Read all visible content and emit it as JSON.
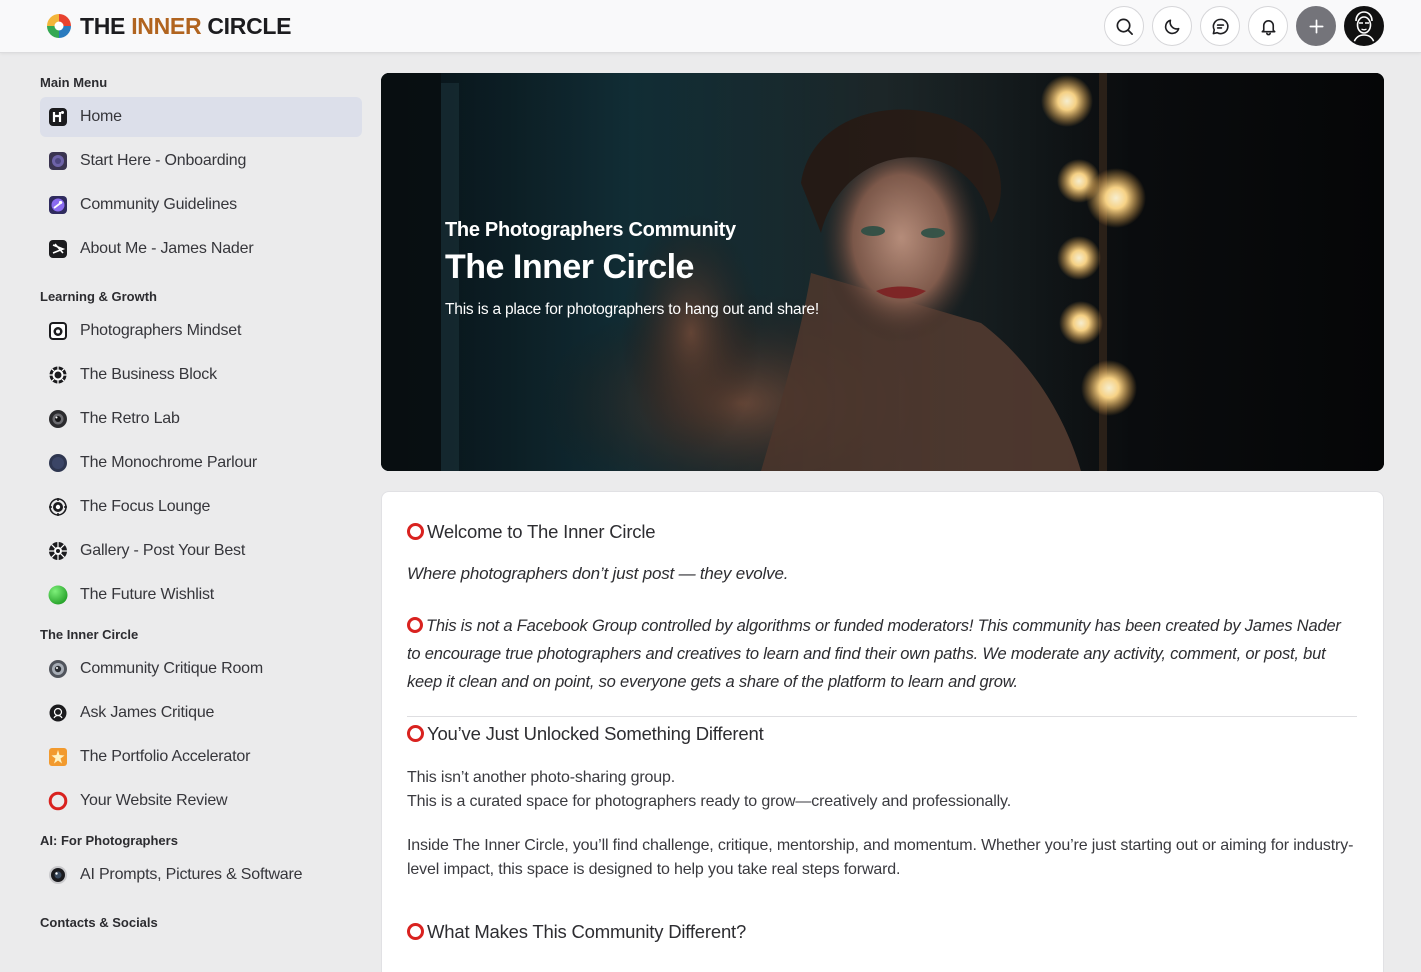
{
  "header": {
    "brand_prefix": "THE ",
    "brand_accent": "INNER",
    "brand_suffix": " CIRCLE",
    "actions": [
      {
        "name": "search-icon"
      },
      {
        "name": "moon-icon"
      },
      {
        "name": "chat-icon"
      },
      {
        "name": "bell-icon"
      },
      {
        "name": "plus-icon"
      },
      {
        "name": "avatar"
      }
    ]
  },
  "sidebar": {
    "main_menu": {
      "title": "Main Menu",
      "items": [
        {
          "label": "Home",
          "icon": "home-icon",
          "active": true
        },
        {
          "label": "Start Here - Onboarding",
          "icon": "onboarding-icon"
        },
        {
          "label": "Community Guidelines",
          "icon": "guidelines-icon"
        },
        {
          "label": "About Me - James Nader",
          "icon": "about-icon"
        }
      ]
    },
    "learning": {
      "title": "Learning & Growth",
      "items": [
        {
          "label": "Photographers Mindset",
          "icon": "camera-icon"
        },
        {
          "label": "The Business Block",
          "icon": "gear-icon"
        },
        {
          "label": "The Retro Lab",
          "icon": "retro-camera-icon"
        },
        {
          "label": "The Monochrome Parlour",
          "icon": "monochrome-icon"
        },
        {
          "label": "The Focus Lounge",
          "icon": "focus-icon"
        },
        {
          "label": "Gallery - Post Your Best",
          "icon": "aperture-icon"
        },
        {
          "label": "The Future Wishlist",
          "icon": "green-dot-icon"
        }
      ]
    },
    "inner_circle": {
      "title": "The Inner Circle",
      "items": [
        {
          "label": "Community Critique Room",
          "icon": "critique-icon"
        },
        {
          "label": "Ask James Critique",
          "icon": "ask-icon"
        },
        {
          "label": "The Portfolio Accelerator",
          "icon": "spark-icon"
        },
        {
          "label": "Your Website Review",
          "icon": "red-ring-icon"
        }
      ]
    },
    "ai": {
      "title": "AI: For Photographers",
      "items": [
        {
          "label": "AI Prompts, Pictures & Software",
          "icon": "lens-icon"
        }
      ]
    },
    "contacts": {
      "title": "Contacts & Socials"
    }
  },
  "hero": {
    "kicker": "The Photographers Community",
    "title": "The Inner Circle",
    "subtitle": "This is a place for photographers to hang out and share!"
  },
  "content": {
    "welcome_heading": "Welcome to The Inner Circle",
    "tagline": "Where photographers don’t just post — they evolve.",
    "intro": "This is not a Facebook Group controlled by algorithms or funded moderators! This community has been created by James Nader to encourage true photographers and creatives to learn and find their own paths. We moderate any activity, comment, or post, but keep it clean and on point, so everyone gets a share of the platform to learn and grow.",
    "unlocked_heading": "You’ve Just Unlocked Something Different",
    "unlocked_line1": "This isn’t another photo-sharing group.",
    "unlocked_line2": "This is a curated space for photographers ready to grow—creatively and professionally.",
    "inside_para": "Inside The Inner Circle, you’ll find challenge, critique, mentorship, and momentum. Whether you’re just starting out or aiming for industry-level impact, this space is designed to help you take real steps forward.",
    "different_heading": "What Makes This Community Different?"
  },
  "colors": {
    "brand_accent": "#b1641f",
    "ring_red": "#d9221f",
    "active_bg": "#dcdfea"
  }
}
